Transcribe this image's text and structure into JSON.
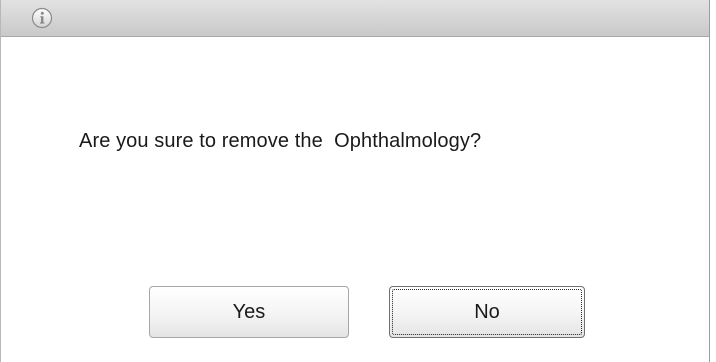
{
  "dialog": {
    "icon": "info-icon",
    "message": "Are you sure to remove the  Ophthalmology?",
    "buttons": {
      "yes_label": "Yes",
      "no_label": "No"
    }
  }
}
